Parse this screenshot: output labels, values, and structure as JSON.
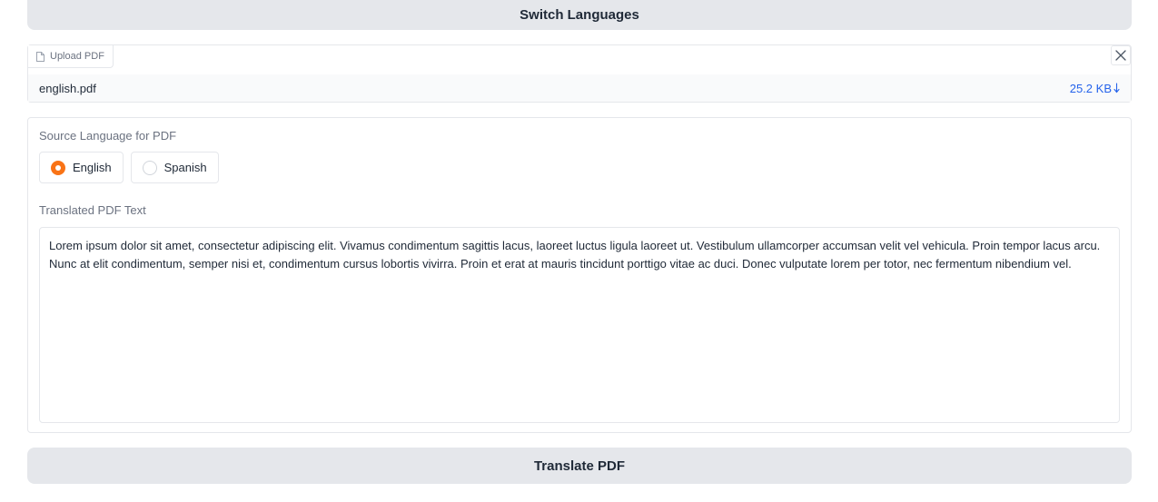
{
  "switch_button": {
    "label": "Switch Languages"
  },
  "upload": {
    "label": "Upload PDF",
    "file_name": "english.pdf",
    "file_size": "25.2 KB"
  },
  "source_language": {
    "label": "Source Language for PDF",
    "options": [
      {
        "label": "English",
        "selected": true
      },
      {
        "label": "Spanish",
        "selected": false
      }
    ]
  },
  "translated_text": {
    "label": "Translated PDF Text",
    "value": "Lorem ipsum dolor sit amet, consectetur adipiscing elit. Vivamus condimentum sagittis lacus, laoreet luctus ligula laoreet ut. Vestibulum ullamcorper accumsan velit vel vehicula. Proin tempor lacus arcu. Nunc at elit condimentum, semper nisi et, condimentum cursus lobortis vivirra. Proin et erat at mauris tincidunt porttigo vitae ac duci. Donec vulputate lorem per totor, nec fermentum nibendium vel."
  },
  "translate_button": {
    "label": "Translate PDF"
  },
  "colors": {
    "accent": "#f97316",
    "link": "#2563eb",
    "button_bg": "#e5e7eb"
  },
  "icons": {
    "upload": "file-icon",
    "close": "close-icon",
    "download": "download-arrow-icon"
  }
}
